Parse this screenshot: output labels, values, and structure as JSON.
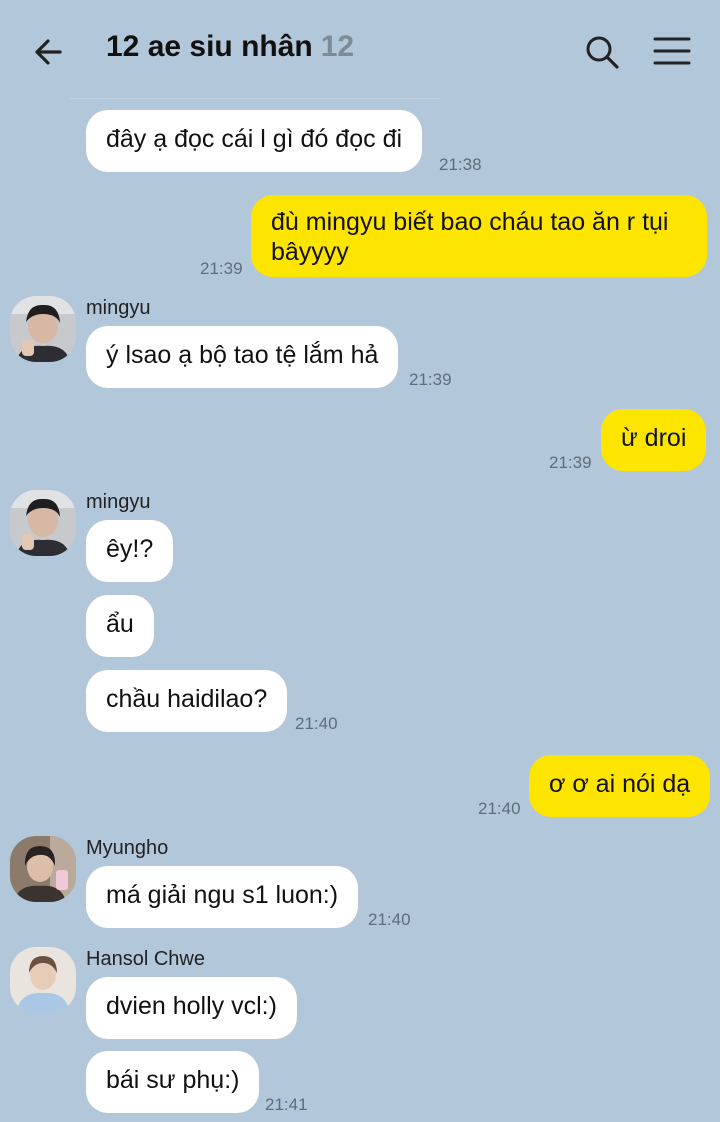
{
  "header": {
    "title": "12 ae siu nhân",
    "member_count": "12",
    "back_icon": "back-arrow-icon",
    "search_icon": "search-icon",
    "menu_icon": "hamburger-menu-icon"
  },
  "colors": {
    "background": "#b2c7d9",
    "incoming_bubble": "#ffffff",
    "outgoing_bubble": "#fee500"
  },
  "messages": [
    {
      "direction": "in",
      "text": "đây ạ đọc cái l gì đó đọc đi",
      "time": "21:38"
    },
    {
      "direction": "out",
      "text_line1": "đù mingyu biết bao cháu tao ăn r tụi",
      "text_line2": "bâyyyy",
      "time": "21:39"
    },
    {
      "direction": "in",
      "sender": "mingyu",
      "text": "ý lsao ạ bộ tao tệ lắm hả",
      "time": "21:39"
    },
    {
      "direction": "out",
      "text": "ừ droi",
      "time": "21:39"
    },
    {
      "direction": "in",
      "sender": "mingyu",
      "text": "êy!?"
    },
    {
      "direction": "in",
      "text": "ẩu"
    },
    {
      "direction": "in",
      "text": "chầu haidilao?",
      "time": "21:40"
    },
    {
      "direction": "out",
      "text": "ơ ơ ai nói dạ",
      "time": "21:40"
    },
    {
      "direction": "in",
      "sender": "Myungho",
      "text": "má giải ngu s1 luon:)",
      "time": "21:40"
    },
    {
      "direction": "in",
      "sender": "Hansol Chwe",
      "text": "dvien holly vcl:)"
    },
    {
      "direction": "in",
      "text": "bái sư phụ:)",
      "time": "21:41"
    }
  ]
}
